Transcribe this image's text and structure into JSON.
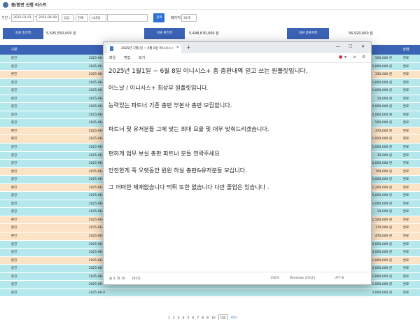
{
  "app": {
    "title": "충/환전 신청 리스트"
  },
  "filters": {
    "period_label": "기간 :",
    "date_from": "2025-01-01",
    "sep": "~",
    "date_to": "2025-06-08",
    "type_select": "입금",
    "status_select": "전체",
    "search_by": "닉네임",
    "search_value": "",
    "search_button": "검색",
    "page_size_label": "페이지수",
    "page_size": "30개"
  },
  "summary": [
    {
      "label": "회원 충전액",
      "value": "5,505,550,000 원"
    },
    {
      "label": "회원 환전액",
      "value": "5,448,630,000 원"
    },
    {
      "label": "회원 충환차액",
      "value": "56,920,000 원"
    }
  ],
  "table": {
    "headers": {
      "type": "구분",
      "status": "상태"
    },
    "rows": [
      {
        "type": "충전",
        "date": "2025-06-0",
        "amount": "500,000 원",
        "status": "완료",
        "kind": "dep"
      },
      {
        "type": "충전",
        "date": "2025-06-0",
        "amount": "5,000,000 원",
        "status": "완료",
        "kind": "dep"
      },
      {
        "type": "환전",
        "date": "2025-06-0",
        "amount": "330,000 원",
        "status": "완료",
        "kind": "wd"
      },
      {
        "type": "충전",
        "date": "2025-06-0",
        "amount": "1,000,000 원",
        "status": "완료",
        "kind": "dep"
      },
      {
        "type": "충전",
        "date": "2025-06-0",
        "amount": "1,000,000 원",
        "status": "완료",
        "kind": "dep"
      },
      {
        "type": "충전",
        "date": "2025-06-0",
        "amount": "10,000 원",
        "status": "완료",
        "kind": "dep"
      },
      {
        "type": "충전",
        "date": "2025-06-0",
        "amount": "2,000,000 원",
        "status": "완료",
        "kind": "dep"
      },
      {
        "type": "충전",
        "date": "2025-06-0",
        "amount": "2,000,000 원",
        "status": "완료",
        "kind": "dep"
      },
      {
        "type": "충전",
        "date": "2025-06-0",
        "amount": "500,000 원",
        "status": "완료",
        "kind": "dep"
      },
      {
        "type": "환전",
        "date": "2025-06-0",
        "amount": "370,000 원",
        "status": "완료",
        "kind": "wd"
      },
      {
        "type": "환전",
        "date": "2025-06-0",
        "amount": "1,920,000 원",
        "status": "완료",
        "kind": "wd"
      },
      {
        "type": "충전",
        "date": "2025-06-0",
        "amount": "1,000,000 원",
        "status": "완료",
        "kind": "dep"
      },
      {
        "type": "충전",
        "date": "2025-06-0",
        "amount": "30,000 원",
        "status": "완료",
        "kind": "dep"
      },
      {
        "type": "충전",
        "date": "2025-06-0",
        "amount": "2,000,000 원",
        "status": "완료",
        "kind": "dep"
      },
      {
        "type": "환전",
        "date": "2025-06-0",
        "amount": "700,000 원",
        "status": "완료",
        "kind": "wd"
      },
      {
        "type": "충전",
        "date": "2025-06-0",
        "amount": "1,000,000 원",
        "status": "완료",
        "kind": "dep"
      },
      {
        "type": "환전",
        "date": "2025-06-0",
        "amount": "1,200,000 원",
        "status": "완료",
        "kind": "wd"
      },
      {
        "type": "충전",
        "date": "2025-06-0",
        "amount": "5,000,000 원",
        "status": "완료",
        "kind": "dep"
      },
      {
        "type": "충전",
        "date": "2025-06-0",
        "amount": "1,000,000 원",
        "status": "완료",
        "kind": "dep"
      },
      {
        "type": "충전",
        "date": "2025-06-0",
        "amount": "10,000 원",
        "status": "완료",
        "kind": "dep"
      },
      {
        "type": "환전",
        "date": "2025-06-0",
        "amount": "1,500,000 원",
        "status": "완료",
        "kind": "wd"
      },
      {
        "type": "환전",
        "date": "2025-06-0",
        "amount": "170,000 원",
        "status": "완료",
        "kind": "wd"
      },
      {
        "type": "환전",
        "date": "2025-06-0",
        "amount": "470,000 원",
        "status": "완료",
        "kind": "wd"
      },
      {
        "type": "충전",
        "date": "2025-06-0",
        "amount": "2,000,000 원",
        "status": "완료",
        "kind": "dep"
      },
      {
        "type": "충전",
        "date": "2025-06-0",
        "amount": "5,000,000 원",
        "status": "완료",
        "kind": "dep"
      },
      {
        "type": "환전",
        "date": "2025-06-0",
        "amount": "1,000,000 원",
        "status": "완료",
        "kind": "wd"
      },
      {
        "type": "충전",
        "date": "2025-06-0",
        "amount": "5,000,000 원",
        "status": "완료",
        "kind": "dep"
      },
      {
        "type": "충전",
        "date": "2025-06-0",
        "amount": "1,000,000 원",
        "status": "완료",
        "kind": "dep"
      },
      {
        "type": "충전",
        "date": "2025-06-0",
        "amount": "1,000,000 원",
        "status": "완료",
        "kind": "dep"
      },
      {
        "type": "충전",
        "date": "2025-06-0",
        "amount": "2,000,000 원",
        "status": "완료",
        "kind": "dep"
      }
    ]
  },
  "pagination": {
    "pages": [
      "1",
      "2",
      "3",
      "4",
      "5",
      "6",
      "7",
      "8",
      "9",
      "10"
    ],
    "selected": "다음",
    "next": "마지"
  },
  "notepad": {
    "tab_title": "2025년 1월1일 ~ 6월 8일 이니시스+",
    "menu": {
      "file": "파일",
      "edit": "편집",
      "view": "보기"
    },
    "lines": [
      "2025년 1월1일 ~ 6월 8일 이니시스+ 총 충환내역 믿고 쓰는 원플릿입니다.",
      "어느날 / 이니시스+ 최상부 원플릿입니다.",
      "능력있는 파트너 기존 총판 부본사 총판 모집합니다.",
      "파트너 및 유저분들 그에 맞는 최대 요율 및 대우 맞춰드리겠습니다.",
      "편하게 업무 보실 총판 파트너 분들 연락주세요",
      "안전한게 쭉 오랫동안 윈윈 하실 총판&유저분들 모십니다.",
      "그 어떠한 제재없습니다 먹튀 또한 없습니다 다만 졸업은 있습니다 ."
    ],
    "status": {
      "position": "줄 3, 열 19",
      "chars": "245자",
      "zoom": "150%",
      "eol": "Windows (CRLF)",
      "encoding": "UTF-8"
    }
  },
  "colors": {
    "accent": "#3b63b6",
    "deposit_row": "#b5e8ec",
    "withdraw_row": "#fde3c5",
    "search_button": "#2f6fd8"
  }
}
